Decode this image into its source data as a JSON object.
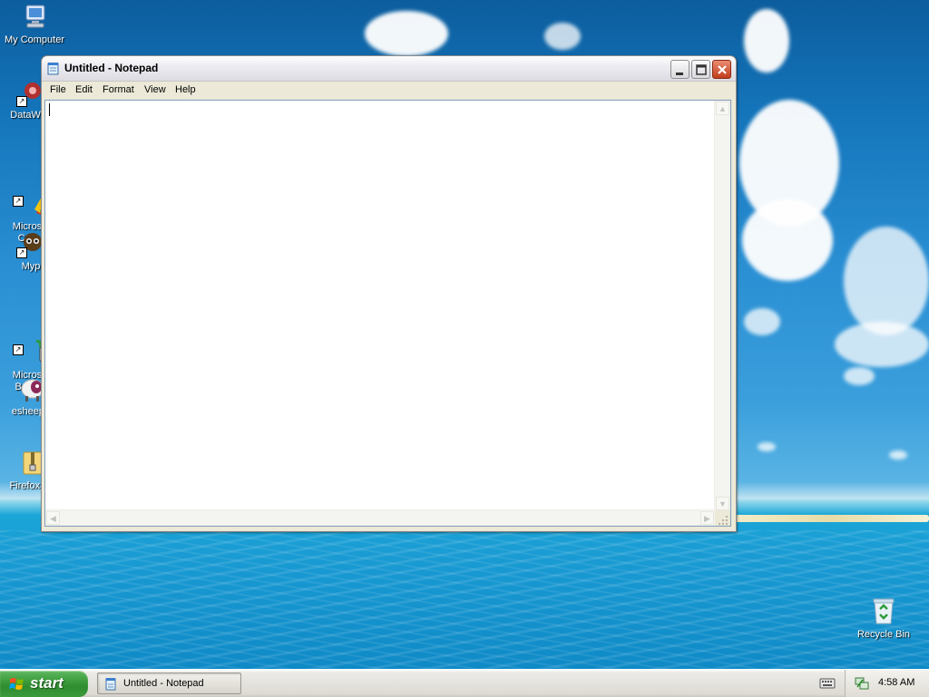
{
  "desktop": {
    "icons": [
      {
        "label": "My Computer"
      },
      {
        "label": "DataWag"
      },
      {
        "label": "Microsoft\nC++"
      },
      {
        "label": "Myp"
      },
      {
        "label": "Microsoft\nBasic"
      },
      {
        "label": "esheep_"
      },
      {
        "label": "Firefox_E"
      }
    ],
    "recycle_bin": "Recycle Bin"
  },
  "notepad": {
    "title": "Untitled - Notepad",
    "menu": [
      "File",
      "Edit",
      "Format",
      "View",
      "Help"
    ],
    "content": ""
  },
  "taskbar": {
    "start_label": "start",
    "task_label": "Untitled - Notepad",
    "clock": "4:58 AM"
  },
  "colors": {
    "start_green": "#3c9c3c",
    "close_red": "#c13d1b",
    "editor_border": "#7f9db9"
  },
  "icons": {
    "window_controls": [
      "minimize-icon",
      "maximize-icon",
      "close-icon"
    ],
    "tray": [
      "keyboard-icon",
      "network-icon"
    ]
  }
}
